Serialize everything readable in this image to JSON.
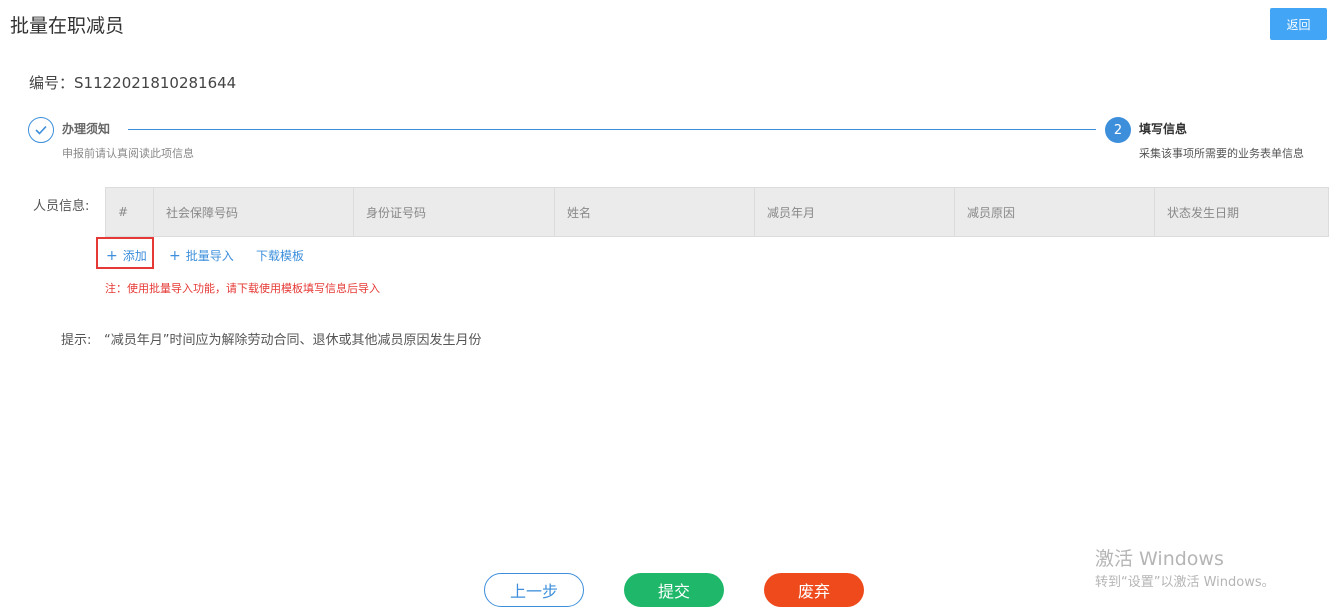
{
  "header": {
    "title": "批量在职减员",
    "back_label": "返回"
  },
  "record": {
    "number_text": "编号：S1122021810281644"
  },
  "steps": [
    {
      "index": "",
      "title": "办理须知",
      "desc": "申报前请认真阅读此项信息",
      "status": "done"
    },
    {
      "index": "2",
      "title": "填写信息",
      "desc": "采集该事项所需要的业务表单信息",
      "status": "active"
    }
  ],
  "table": {
    "label": "人员信息:",
    "columns": [
      "#",
      "社会保障号码",
      "身份证号码",
      "姓名",
      "减员年月",
      "减员原因",
      "状态发生日期"
    ],
    "rows": []
  },
  "actions": {
    "add": "添加",
    "batch_import": "批量导入",
    "download_template": "下载模板"
  },
  "note": "注：使用批量导入功能，请下载使用模板填写信息后导入",
  "tip": {
    "label": "提示:",
    "text": "“减员年月”时间应为解除劳动合同、退休或其他减员原因发生月份"
  },
  "buttons": {
    "prev": "上一步",
    "submit": "提交",
    "discard": "废弃"
  },
  "watermark": {
    "title": "激活 Windows",
    "subtitle": "转到“设置”以激活 Windows。"
  },
  "colors": {
    "primary": "#3d8fdb",
    "back_button": "#42a5f5",
    "submit": "#1fb86a",
    "discard": "#ee4a1c",
    "warning": "#e53935"
  }
}
